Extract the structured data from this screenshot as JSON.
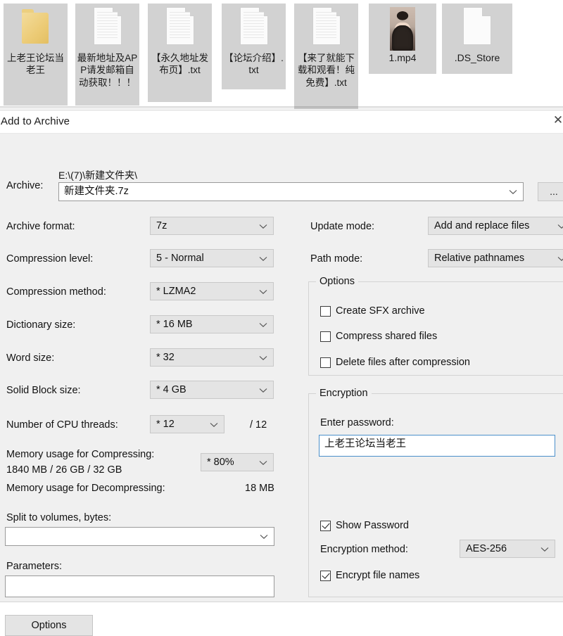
{
  "explorer": {
    "files": [
      {
        "name": "上老王论坛当老王",
        "icon": "folder-icon",
        "script": "cjk"
      },
      {
        "name": "最新地址及APP请发邮箱自动获取！！！",
        "icon": "text-document-icon",
        "script": "cjk"
      },
      {
        "name": "【永久地址发布页】.txt",
        "icon": "text-document-icon",
        "script": "cjk"
      },
      {
        "name": "【论坛介绍】.txt",
        "icon": "text-document-icon",
        "script": "cjk"
      },
      {
        "name": "【来了就能下载和观看！纯免费】.txt",
        "icon": "text-document-icon",
        "script": "cjk"
      },
      {
        "name": "1.mp4",
        "icon": "video-thumbnail-icon",
        "script": "latin"
      },
      {
        "name": ".DS_Store",
        "icon": "blank-document-icon",
        "script": "latin"
      }
    ]
  },
  "dialog": {
    "title": "Add to Archive",
    "close_icon": "close-icon",
    "archive": {
      "label": "Archive:",
      "path": "E:\\(7)\\新建文件夹\\",
      "value": "新建文件夹.7z",
      "browse_label": "..."
    },
    "left": {
      "archive_format": {
        "label": "Archive format:",
        "value": "7z"
      },
      "compression_level": {
        "label": "Compression level:",
        "value": "5 - Normal"
      },
      "compression_method": {
        "label": "Compression method:",
        "value": "*  LZMA2"
      },
      "dictionary_size": {
        "label": "Dictionary size:",
        "value": "*  16 MB"
      },
      "word_size": {
        "label": "Word size:",
        "value": "*  32"
      },
      "solid_block_size": {
        "label": "Solid Block size:",
        "value": "*  4 GB"
      },
      "cpu_threads": {
        "label": "Number of CPU threads:",
        "value": "*  12",
        "max": "/ 12"
      },
      "memory_compress": {
        "label": "Memory usage for Compressing:",
        "detail": "1840 MB / 26 GB / 32 GB",
        "value": "* 80%"
      },
      "memory_decompress": {
        "label": "Memory usage for Decompressing:",
        "value": "18 MB"
      },
      "split_volumes": {
        "label": "Split to volumes, bytes:",
        "value": ""
      },
      "parameters": {
        "label": "Parameters:",
        "value": ""
      },
      "options_button": "Options"
    },
    "right": {
      "update_mode": {
        "label": "Update mode:",
        "value": "Add and replace files"
      },
      "path_mode": {
        "label": "Path mode:",
        "value": "Relative pathnames"
      },
      "options_group": {
        "title": "Options",
        "items": [
          {
            "label": "Create SFX archive",
            "checked": false
          },
          {
            "label": "Compress shared files",
            "checked": false
          },
          {
            "label": "Delete files after compression",
            "checked": false
          }
        ]
      },
      "encryption_group": {
        "title": "Encryption",
        "password_label": "Enter password:",
        "password_value": "上老王论坛当老王",
        "show_password": {
          "label": "Show Password",
          "checked": true
        },
        "encryption_method": {
          "label": "Encryption method:",
          "value": "AES-256"
        },
        "encrypt_file_names": {
          "label": "Encrypt file names",
          "checked": true
        }
      }
    }
  },
  "colors": {
    "dialog_bg": "#f0f0f0",
    "combo_bg": "#e4e4e4",
    "focus_border": "#4b8fca",
    "tile_bg": "#d2d2d2",
    "folder": "#eccb76"
  }
}
